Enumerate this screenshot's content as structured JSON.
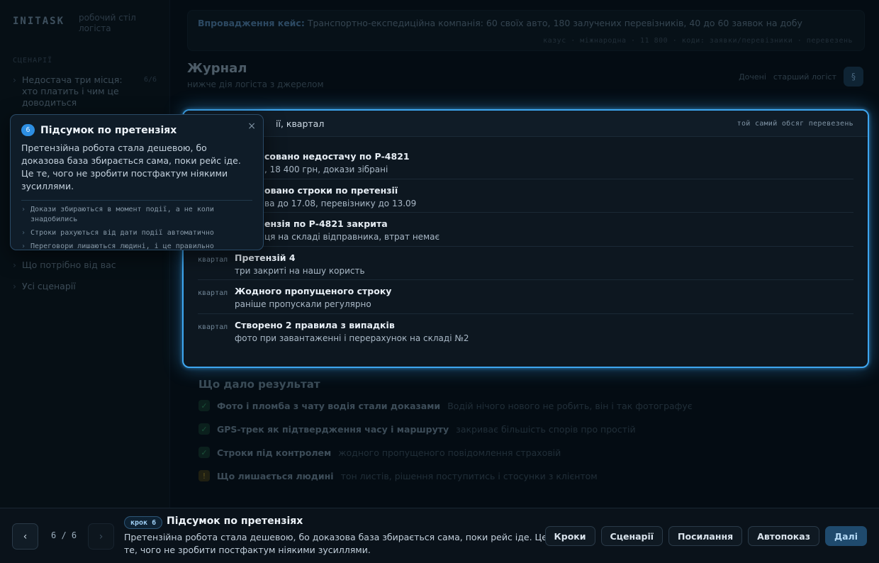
{
  "sidebar": {
    "logo": "INITASK",
    "subtitle": "робочий стіл логіста",
    "section": "СЦЕНАРІЇ",
    "items": [
      {
        "label": "Недостача три місця: хто платить і чим це доводиться",
        "count": "6/6"
      },
      {
        "label": "Що потрібно від вас"
      },
      {
        "label": "Усі сценарії"
      }
    ]
  },
  "banner": {
    "label": "Впровадження кейс:",
    "text": "Транспортно-експедиційна компанія: 60 своїх авто, 180 залучених перевізників, 40 до 60 заявок на добу",
    "meta": "казус · міжнародна · 11 800 · коди: заявки/перевізники · перевезень"
  },
  "journal": {
    "title": "Журнал",
    "subtitle": "нижче дія логіста з джерелом",
    "tools_label1": "Дочені",
    "tools_label2": "старший логіст",
    "tools_btn": "§"
  },
  "card": {
    "title_visible": "ії, квартал",
    "meta": "той самий обсяг перевезень",
    "rows": [
      {
        "when": "",
        "title": "совано недостачу по Р-4821",
        "detail": ", 18 400 грн, докази зібрані"
      },
      {
        "when": "",
        "title": "овано строки по претензії",
        "detail": "ва до 17.08, перевізнику до 13.09"
      },
      {
        "when": "",
        "title": "ензія по Р-4821 закрита",
        "detail": "ця на складі відправника, втрат немає"
      },
      {
        "when": "квартал",
        "title": "Претензій 4",
        "detail": "три закриті на нашу користь"
      },
      {
        "when": "квартал",
        "title": "Жодного пропущеного строку",
        "detail": "раніше пропускали регулярно"
      },
      {
        "when": "квартал",
        "title": "Створено 2 правила з випадків",
        "detail": "фото при завантаженні і перерахунок на складі №2"
      }
    ]
  },
  "results": {
    "title": "Що дало результат",
    "items": [
      {
        "mark": "✓",
        "title": "Фото і пломба з чату водія стали доказами",
        "desc": "Водій нічого нового не робить, він і так фотографує"
      },
      {
        "mark": "✓",
        "title": "GPS-трек як підтвердження часу і маршруту",
        "desc": "закриває більшість спорів про простій"
      },
      {
        "mark": "✓",
        "title": "Строки під контролем",
        "desc": "жодного пропущеного повідомлення страховій"
      },
      {
        "mark": "!",
        "title": "Що лишається людині",
        "desc": "тон листів, рішення поступитись і стосунки з клієнтом"
      }
    ]
  },
  "popover": {
    "number": "6",
    "title": "Підсумок по претензіях",
    "close": "×",
    "text": "Претензійна робота стала дешевою, бо доказова база збирається сама, поки рейс іде. Це те, чого не зробити постфактум ніякими зусиллями.",
    "bullets": [
      "Докази збираються в момент події, а не коли знадобились",
      "Строки рахуються від дати події автоматично",
      "Переговори лишаються людині, і це правильно"
    ]
  },
  "bottom": {
    "prev": "‹",
    "next": "›",
    "counter": "6 / 6",
    "step_badge": "крок 6",
    "step_title": "Підсумок по претензіях",
    "step_desc": "Претензійна робота стала дешевою, бо доказова база збирається сама, поки рейс іде. Це те, чого не зробити постфактум ніякими зусиллями.",
    "actions": [
      "Кроки",
      "Сценарії",
      "Посилання",
      "Автопоказ",
      "Далі"
    ]
  },
  "colors": {
    "accent": "#3ea6f0",
    "background": "#071018",
    "primary_button": "#1f4a6d"
  }
}
